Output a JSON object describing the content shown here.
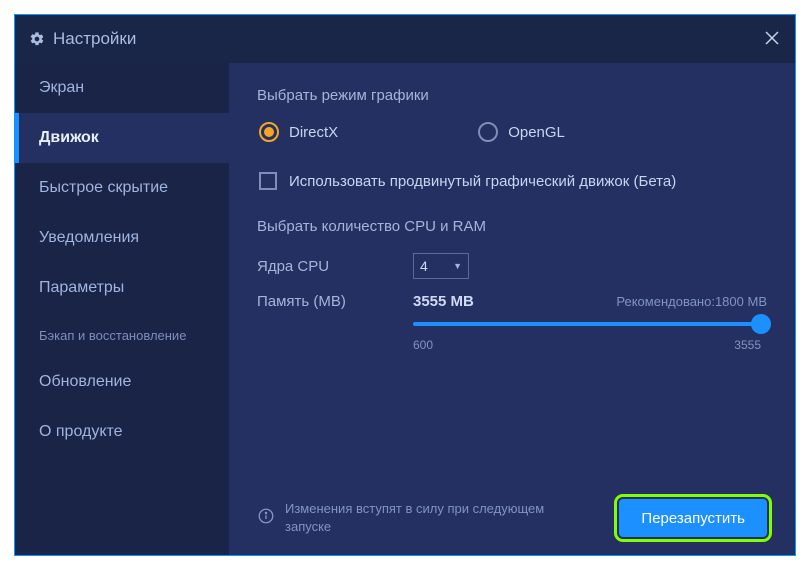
{
  "window": {
    "title": "Настройки",
    "close_label": "Close"
  },
  "sidebar": {
    "items": [
      {
        "label": "Экран",
        "active": false
      },
      {
        "label": "Движок",
        "active": true
      },
      {
        "label": "Быстрое скрытие",
        "active": false
      },
      {
        "label": "Уведомления",
        "active": false
      },
      {
        "label": "Параметры",
        "active": false
      },
      {
        "label": "Бэкап и восстановление",
        "active": false,
        "small": true
      },
      {
        "label": "Обновление",
        "active": false
      },
      {
        "label": "О продукте",
        "active": false
      }
    ]
  },
  "content": {
    "graphics_mode_title": "Выбрать режим графики",
    "radio_directx": "DirectX",
    "radio_opengl": "OpenGL",
    "advanced_engine_label": "Использовать продвинутый графический движок (Бета)",
    "cpu_ram_title": "Выбрать количество CPU и RAM",
    "cpu_label": "Ядра CPU",
    "cpu_value": "4",
    "memory_label": "Память (MB)",
    "memory_value": "3555 MB",
    "recommended_label": "Рекомендовано:1800 MB",
    "slider_min": "600",
    "slider_max": "3555"
  },
  "footer": {
    "info_text": "Изменения вступят в силу при следующем запуске",
    "restart_label": "Перезапустить"
  },
  "colors": {
    "accent": "#1d90ff",
    "radio_selected": "#f5a623",
    "highlight_outline": "#7fff00"
  }
}
